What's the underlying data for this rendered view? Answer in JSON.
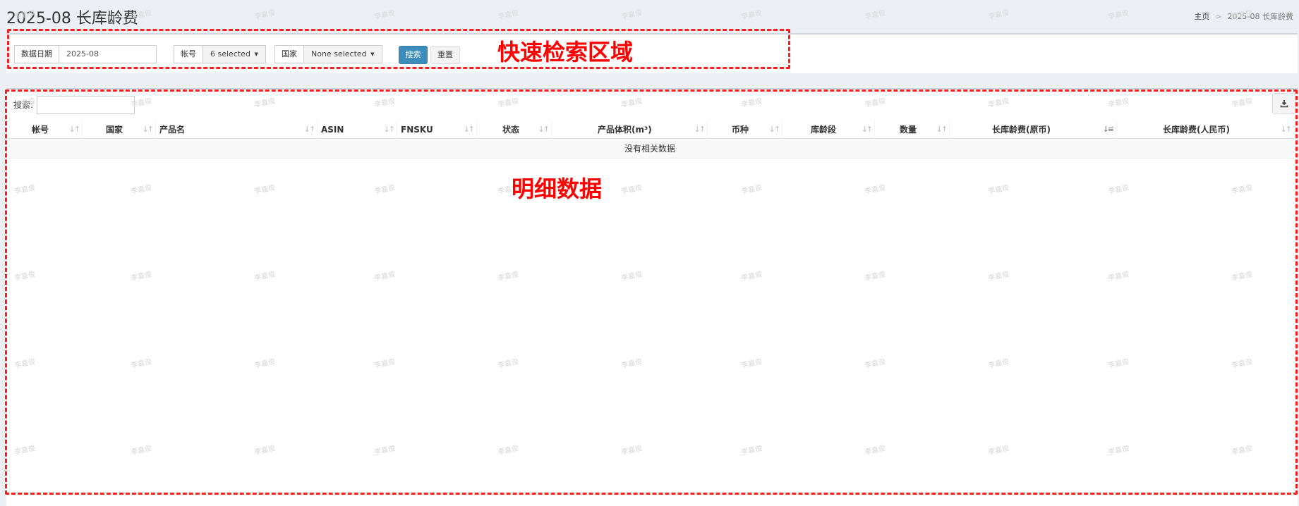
{
  "header": {
    "title": "2025-08 长库龄费",
    "breadcrumb": {
      "home": "主页",
      "separator": ">",
      "current": "2025-08 长库龄费"
    }
  },
  "filters": {
    "data_date": {
      "label": "数据日期",
      "value": "2025-08"
    },
    "account": {
      "label": "帐号",
      "value": "6 selected"
    },
    "country": {
      "label": "国家",
      "value": "None selected"
    },
    "search_button": "搜索",
    "reset_button": "重置"
  },
  "table": {
    "search_label": "搜索:",
    "search_value": "",
    "columns": [
      "帐号",
      "国家",
      "产品名",
      "ASIN",
      "FNSKU",
      "状态",
      "产品体积(m³)",
      "币种",
      "库龄段",
      "数量",
      "长库龄费(原币)",
      "长库龄费(人民币)"
    ],
    "empty_message": "没有相关数据",
    "export_icon": "download-icon"
  },
  "annotations": {
    "filter_area_label": "快速检索区域",
    "table_area_label": "明细数据",
    "color": "#ff0000"
  },
  "watermark": "李嘉俊",
  "colors": {
    "primary_button": "#3c8dbc",
    "page_background": "#ecf0f5"
  }
}
